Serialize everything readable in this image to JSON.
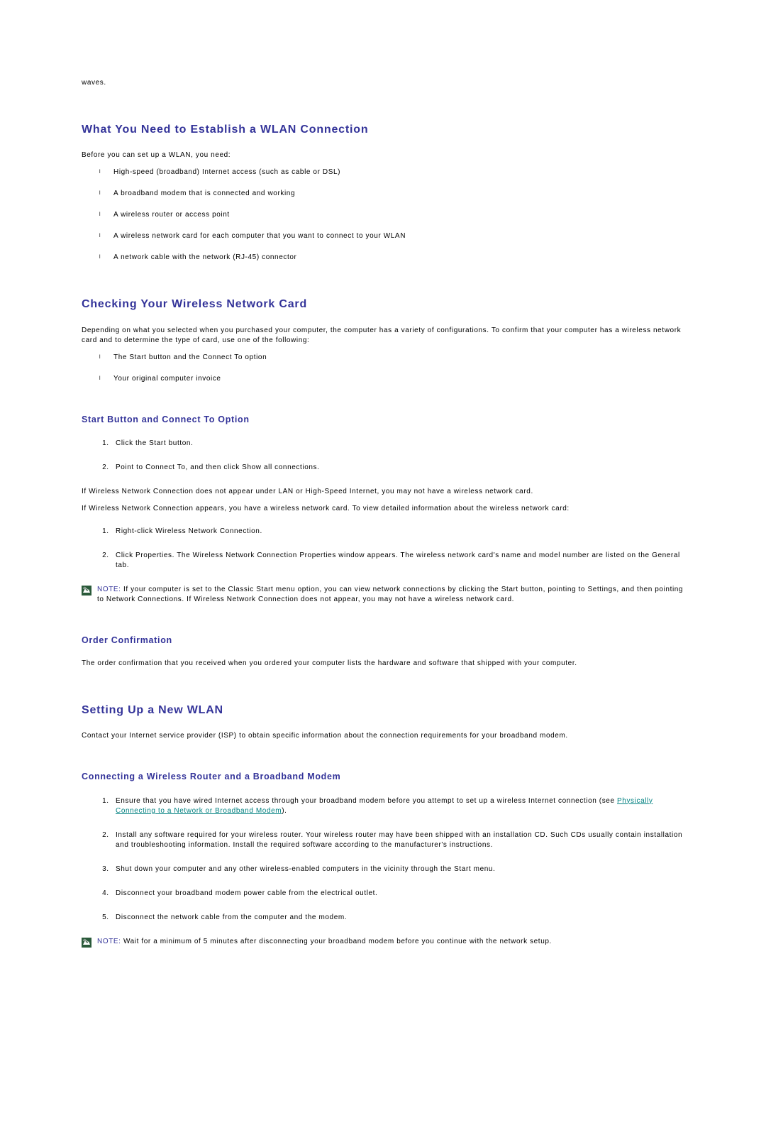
{
  "fragment": "waves.",
  "sections": {
    "wlan_need": {
      "heading": "What You Need to Establish a WLAN Connection",
      "intro": "Before you can set up a WLAN, you need:",
      "items": [
        "High-speed (broadband) Internet access (such as cable or DSL)",
        "A broadband modem that is connected and working",
        "A wireless router or access point",
        "A wireless network card for each computer that you want to connect to your WLAN",
        "A network cable with the network (RJ-45) connector"
      ]
    },
    "check_card": {
      "heading": "Checking Your Wireless Network Card",
      "intro": "Depending on what you selected when you purchased your computer, the computer has a variety of configurations. To confirm that your computer has a wireless network card and to determine the type of card, use one of the following:",
      "items": [
        "The Start button and the Connect To option",
        "Your original computer invoice"
      ]
    },
    "start_button": {
      "heading": "Start Button and Connect To Option",
      "steps1": [
        "Click the Start button.",
        "Point to Connect To, and then click Show all connections."
      ],
      "p1": "If Wireless Network Connection does not appear under LAN or High-Speed Internet, you may not have a wireless network card.",
      "p2": "If Wireless Network Connection appears, you have a wireless network card. To view detailed information about the wireless network card:",
      "steps2": [
        "Right-click Wireless Network Connection.",
        "Click Properties. The Wireless Network Connection Properties window appears. The wireless network card's name and model number are listed on the General tab."
      ],
      "note_label": "NOTE:",
      "note": " If your computer is set to the Classic Start menu option, you can view network connections by clicking the Start button, pointing to Settings, and then pointing to Network Connections. If Wireless Network Connection does not appear, you may not have a wireless network card."
    },
    "order_conf": {
      "heading": "Order Confirmation",
      "p": "The order confirmation that you received when you ordered your computer lists the hardware and software that shipped with your computer."
    },
    "setup_wlan": {
      "heading": "Setting Up a New WLAN",
      "p": "Contact your Internet service provider (ISP) to obtain specific information about the connection requirements for your broadband modem."
    },
    "connecting": {
      "heading": "Connecting a Wireless Router and a Broadband Modem",
      "step1_pre": "Ensure that you have wired Internet access through your broadband modem before you attempt to set up a wireless Internet connection (see ",
      "step1_link": "Physically Connecting to a Network or Broadband Modem",
      "step1_post": ").",
      "steps_rest": [
        "Install any software required for your wireless router. Your wireless router may have been shipped with an installation CD. Such CDs usually contain installation and troubleshooting information. Install the required software according to the manufacturer's instructions.",
        "Shut down your computer and any other wireless-enabled computers in the vicinity through the Start menu.",
        "Disconnect your broadband modem power cable from the electrical outlet.",
        "Disconnect the network cable from the computer and the modem."
      ],
      "note_label": "NOTE:",
      "note": " Wait for a minimum of 5 minutes after disconnecting your broadband modem before you continue with the network setup."
    }
  }
}
